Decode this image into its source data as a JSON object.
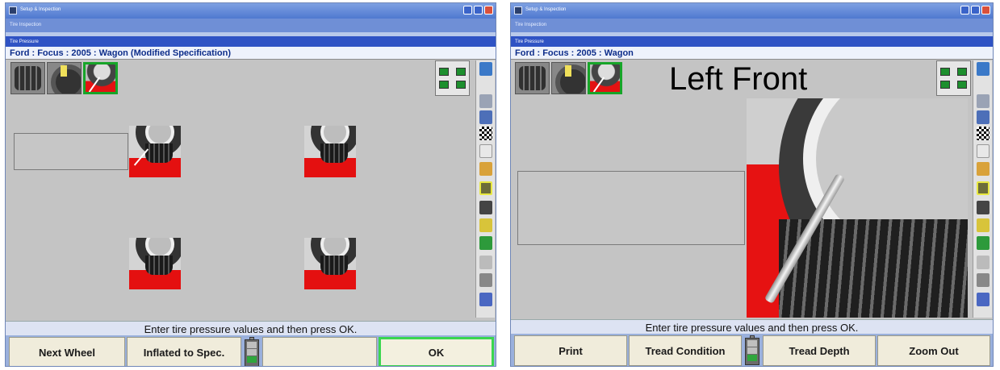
{
  "left_window": {
    "title": "Setup & Inspection",
    "menu": "Tire Inspection",
    "panel_header": "Tire Pressure",
    "vehicle_line": "Ford : Focus : 2005 : Wagon (Modified Specification)",
    "prompt": "Enter tire pressure values and then press OK.",
    "buttons": {
      "next_wheel": "Next Wheel",
      "inflated_to_spec": "Inflated to Spec.",
      "blank": "",
      "ok": "OK"
    },
    "battery_level_pct": 50
  },
  "right_window": {
    "title": "Setup & Inspection",
    "menu": "Tire Inspection",
    "panel_header": "Tire Pressure",
    "vehicle_line": "Ford : Focus : 2005 : Wagon",
    "big_title": "Left Front",
    "prompt": "Enter tire pressure values and then press OK.",
    "buttons": {
      "print": "Print",
      "tread_condition": "Tread Condition",
      "tread_depth": "Tread Depth",
      "zoom_out": "Zoom Out"
    },
    "battery_level_pct": 50
  },
  "icons": {
    "thumbnails": [
      "tire-tread-icon",
      "tire-sidewall-icon",
      "tire-pressure-gauge-icon"
    ],
    "side_tools": [
      "help-icon",
      "vehicle-lift-icon",
      "alignment-icon",
      "checkered-flag-icon",
      "specs-icon",
      "technician-icon",
      "tire-inspection-icon",
      "tire-icon",
      "wrench-icon",
      "measure-icon",
      "thermometer-icon",
      "settings-icon",
      "report-icon"
    ]
  },
  "colors": {
    "accent_green": "#17a529",
    "floor_red": "#e41010",
    "header_blue": "#2f53c4",
    "background_gray": "#c4c4c4"
  }
}
